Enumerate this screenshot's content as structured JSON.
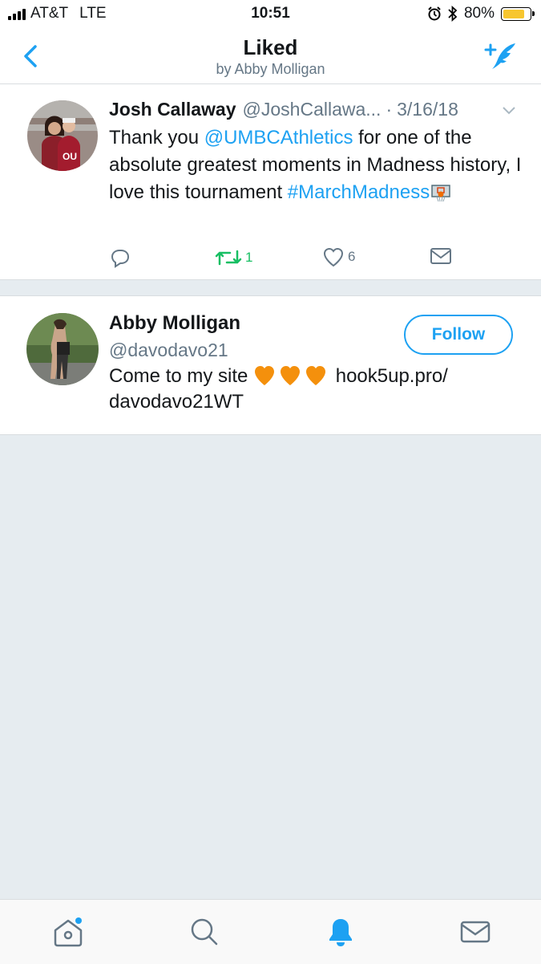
{
  "status_bar": {
    "carrier": "AT&T",
    "network": "LTE",
    "time": "10:51",
    "battery_percent": "80%",
    "battery_level": 0.8,
    "icons": [
      "signal-icon",
      "alarm-icon",
      "bluetooth-icon",
      "battery-icon"
    ]
  },
  "nav": {
    "title": "Liked",
    "subtitle": "by Abby Molligan",
    "back_icon": "chevron-left-icon",
    "compose_icon": "compose-tweet-icon"
  },
  "tweet": {
    "name": "Josh Callaway",
    "handle": "@JoshCallawa...",
    "date_separator": "·",
    "date": "3/16/18",
    "text_prefix": "Thank you ",
    "mention": "@UMBCAthletics",
    "text_middle": " for one of the absolute greatest moments in Madness history, I love this tournament ",
    "hashtag": "#MarchMadness",
    "actions": {
      "reply_count": "",
      "retweet_count": "1",
      "like_count": "6"
    }
  },
  "user_card": {
    "name": "Abby Molligan",
    "handle": "@davodavo21",
    "bio_prefix": "Come to my site ",
    "bio_link": "hook5up.pro/",
    "bio_link2": "davodavo21WT",
    "follow_label": "Follow"
  },
  "tabbar": {
    "tabs": [
      "home-icon",
      "search-icon",
      "notifications-icon",
      "messages-icon"
    ],
    "active": "notifications-icon"
  },
  "colors": {
    "accent": "#1da1f2",
    "retweet": "#17bf63",
    "secondary_text": "#657786",
    "background": "#e6ecf0",
    "battery": "#f7c62f",
    "heart_emoji": "#f4900c"
  }
}
